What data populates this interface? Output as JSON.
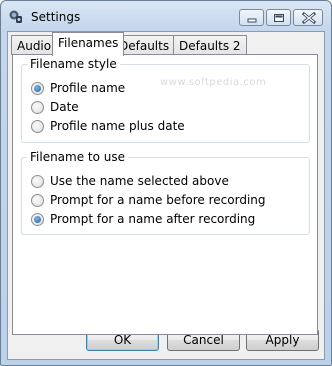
{
  "window": {
    "title": "Settings"
  },
  "watermark": "www.softpedia.com",
  "tabs": [
    {
      "label": "Audio",
      "active": false
    },
    {
      "label": "Filenames",
      "active": true
    },
    {
      "label": "Defaults 1",
      "active": false
    },
    {
      "label": "Defaults 2",
      "active": false
    }
  ],
  "filename_style": {
    "title": "Filename style",
    "options": [
      {
        "label": "Profile name",
        "checked": true
      },
      {
        "label": "Date",
        "checked": false
      },
      {
        "label": "Profile name plus date",
        "checked": false
      }
    ]
  },
  "filename_to_use": {
    "title": "Filename to use",
    "options": [
      {
        "label": "Use the name selected above",
        "checked": false
      },
      {
        "label": "Prompt for a name before recording",
        "checked": false
      },
      {
        "label": "Prompt for a name after recording",
        "checked": true
      }
    ]
  },
  "buttons": {
    "ok": "OK",
    "cancel": "Cancel",
    "apply": "Apply"
  },
  "colors": {
    "title_bar": "#c3d6ec",
    "dialog_face": "#f0f0f0",
    "radio_checked": "#1d5fa6"
  }
}
